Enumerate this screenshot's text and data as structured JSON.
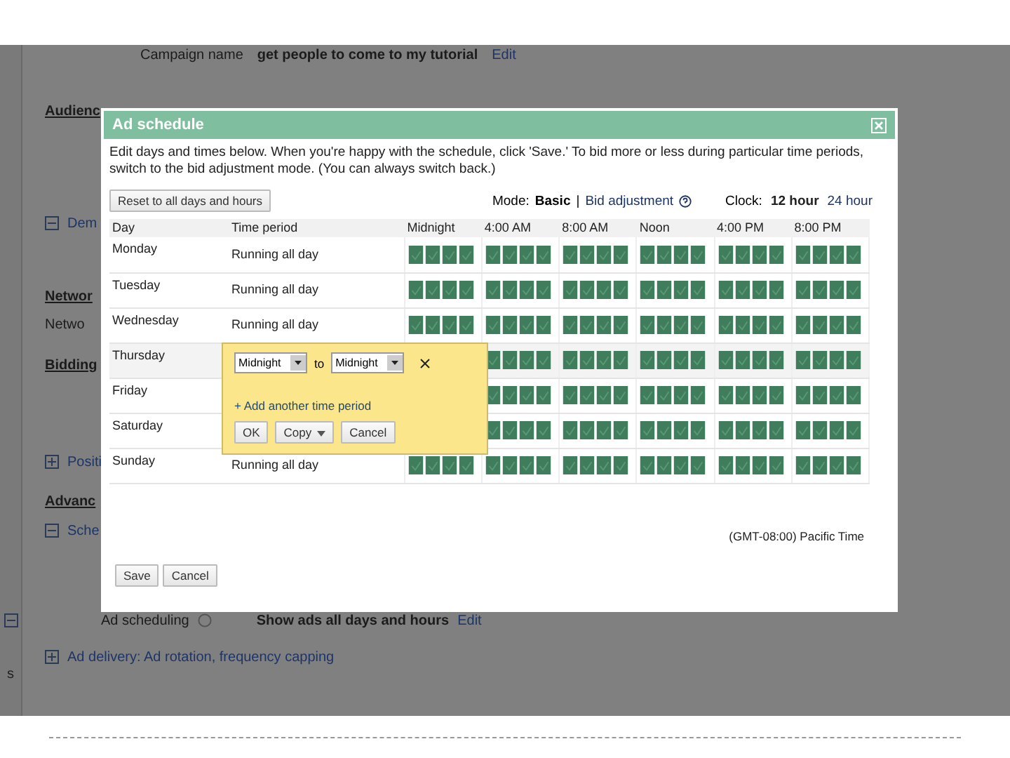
{
  "page": {
    "campaign_label": "Campaign name",
    "campaign_name": "get people to come to my tutorial",
    "campaign_edit": "Edit",
    "sections": [
      {
        "kind": "heading",
        "text": "Audienc"
      },
      {
        "kind": "toggle",
        "text": "Dem",
        "expanded": true
      },
      {
        "kind": "heading",
        "text": "Networ"
      },
      {
        "kind": "label",
        "text": "Netwo"
      },
      {
        "kind": "heading",
        "text": "Bidding"
      },
      {
        "kind": "toggle",
        "text": "Positi",
        "expanded": false
      },
      {
        "kind": "heading",
        "text": "Advanc"
      },
      {
        "kind": "toggle",
        "text": "Sche",
        "expanded": true
      }
    ],
    "ad_scheduling": {
      "label": "Ad scheduling",
      "value": "Show ads all days and hours",
      "edit": "Edit"
    },
    "advanced_toggle": {
      "text": "Ad delivery: Ad rotation, frequency capping",
      "expanded": false
    },
    "sidebar_text": "s"
  },
  "dialog": {
    "title": "Ad schedule",
    "intro": "Edit days and times below. When you're happy with the schedule, click 'Save.' To bid more or less during particular time periods, switch to the bid adjustment mode. (You can always switch back.)",
    "reset_button": "Reset to all days and hours",
    "mode_label": "Mode:",
    "mode_value": "Basic",
    "mode_separator": "|",
    "mode_link": "Bid adjustment",
    "clock_label": "Clock:",
    "clock_options": [
      {
        "label": "12 hour",
        "selected": true
      },
      {
        "label": "24 hour",
        "selected": false
      }
    ],
    "columns": [
      "Day",
      "Time period",
      "Midnight",
      "4:00 AM",
      "8:00 AM",
      "Noon",
      "4:00 PM",
      "8:00 PM"
    ],
    "rows": [
      {
        "day": "Monday",
        "time_period": "Running all day",
        "selected": false,
        "scheduled": true
      },
      {
        "day": "Tuesday",
        "time_period": "Running all day",
        "selected": false,
        "scheduled": true
      },
      {
        "day": "Wednesday",
        "time_period": "Running all day",
        "selected": false,
        "scheduled": true
      },
      {
        "day": "Thursday",
        "selected": true,
        "scheduled": true
      },
      {
        "day": "Friday",
        "selected": false,
        "scheduled": true
      },
      {
        "day": "Saturday",
        "selected": false,
        "scheduled": true
      },
      {
        "day": "Sunday",
        "time_period": "Running all day",
        "selected": false,
        "scheduled": true
      }
    ],
    "popover": {
      "from": "Midnight",
      "connector": "to",
      "to": "Midnight",
      "add_link": "+ Add another time period",
      "buttons": [
        {
          "label": "OK",
          "menu": false
        },
        {
          "label": "Copy",
          "menu": true
        },
        {
          "label": "Cancel",
          "menu": false
        }
      ]
    },
    "timezone": "(GMT-08:00) Pacific Time",
    "buttons": [
      "Save",
      "Cancel"
    ]
  }
}
